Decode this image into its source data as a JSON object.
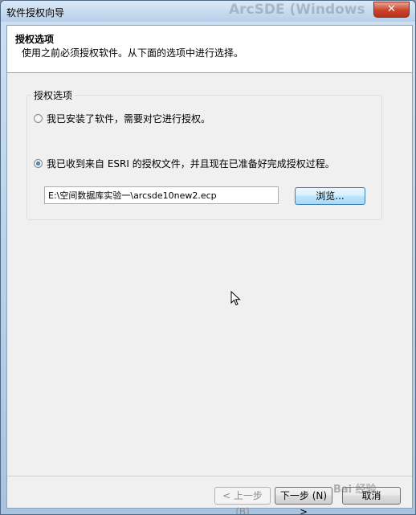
{
  "window": {
    "title": "软件授权向导",
    "background_title": "ArcSDE (Windows",
    "close_glyph": "✕"
  },
  "header": {
    "title": "授权选项",
    "subtitle": "使用之前必须授权软件。从下面的选项中进行选择。"
  },
  "group": {
    "legend": "授权选项",
    "option1": "我已安装了软件，需要对它进行授权。",
    "option2": "我已收到来自 ESRI 的授权文件，并且现在已准备好完成授权过程。",
    "selected": "option2"
  },
  "file": {
    "path": "E:\\空间数据库实验一\\arcsde10new2.ecp",
    "browse_label": "浏览..."
  },
  "footer": {
    "back_label": "< 上一步 (B)",
    "next_label": "下一步 (N) >",
    "cancel_label": "取消",
    "watermark": "Bai 经验"
  },
  "icons": {
    "cursor": "arrow-cursor-icon",
    "radio_checked": "radio-checked-icon",
    "radio_unchecked": "radio-unchecked-icon"
  },
  "colors": {
    "close_red": "#c8432a",
    "focus_blue": "#3c7fb1",
    "radio_dot": "#1f5a9c"
  }
}
